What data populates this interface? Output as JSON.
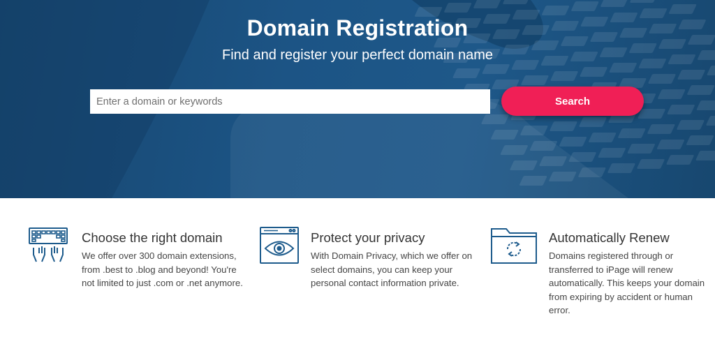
{
  "hero": {
    "title": "Domain Registration",
    "subtitle": "Find and register your perfect domain name",
    "search_placeholder": "Enter a domain or keywords",
    "search_button": "Search"
  },
  "features": [
    {
      "icon": "keyboard-hands-icon",
      "title": "Choose the right domain",
      "text": "We offer over 300 domain extensions, from .best to .blog and beyond! You're not limited to just .com or .net anymore."
    },
    {
      "icon": "browser-eye-icon",
      "title": "Protect your privacy",
      "text": "With Domain Privacy, which we offer on select domains, you can keep your personal contact information private."
    },
    {
      "icon": "folder-refresh-icon",
      "title": "Automatically Renew",
      "text": "Domains registered through or transferred to iPage will renew automatically. This keeps your domain from expiring by accident or human error."
    }
  ],
  "colors": {
    "hero_blue": "#1c5485",
    "search_button": "#f01f56",
    "icon_blue": "#1d5b8c"
  }
}
